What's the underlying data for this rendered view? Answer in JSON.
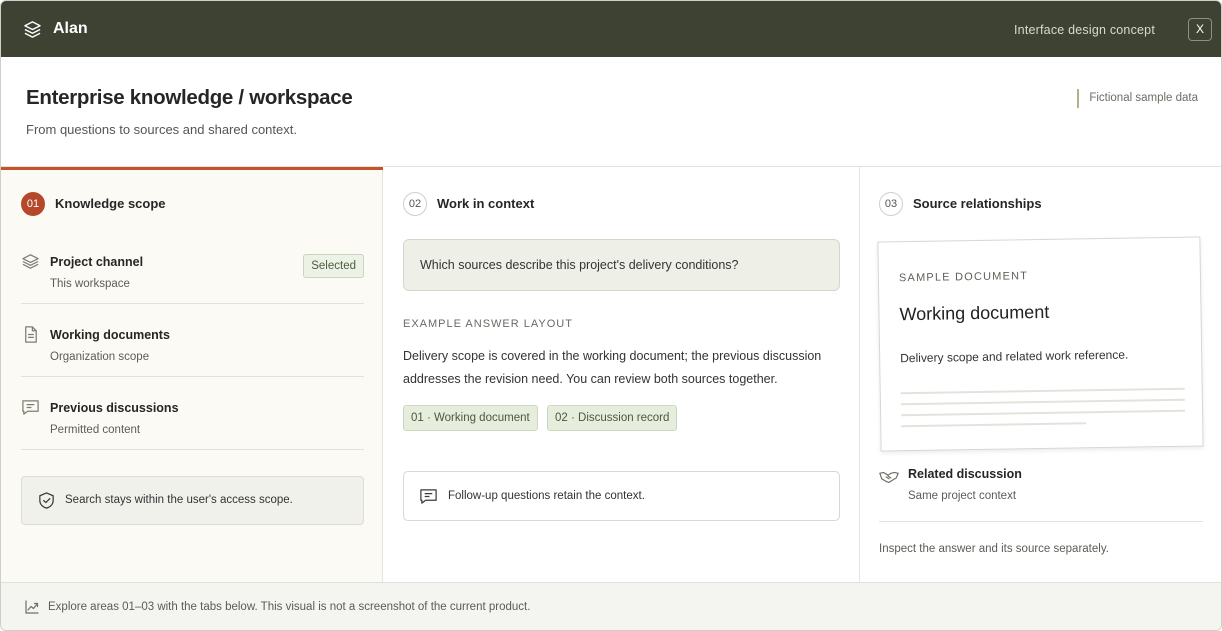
{
  "app": {
    "name": "Alan",
    "concept_label": "Interface design concept",
    "close_label": "X"
  },
  "header": {
    "title": "Enterprise knowledge / workspace",
    "subtitle": "From questions to sources and shared context.",
    "sample_tag": "Fictional sample data"
  },
  "columns": [
    {
      "num": "01",
      "title": "Knowledge scope"
    },
    {
      "num": "02",
      "title": "Work in context"
    },
    {
      "num": "03",
      "title": "Source relationships"
    }
  ],
  "scope": {
    "items": [
      {
        "name": "Project channel",
        "desc": "This workspace",
        "icon": "layers-icon",
        "badge": "Selected"
      },
      {
        "name": "Working documents",
        "desc": "Organization scope",
        "icon": "document-icon"
      },
      {
        "name": "Previous discussions",
        "desc": "Permitted content",
        "icon": "chat-icon"
      }
    ],
    "access_note": "Search stays within the user's access scope."
  },
  "work": {
    "question": "Which sources describe this project's delivery conditions?",
    "answer_label": "EXAMPLE ANSWER LAYOUT",
    "answer_line1": "Delivery scope is covered in the working document; the previous discussion",
    "answer_line2": "addresses the revision need. You can review both sources together.",
    "citations": [
      "01 · Working document",
      "02 · Discussion record"
    ],
    "followup": "Follow-up questions retain the context."
  },
  "sources": {
    "doc_eyebrow": "SAMPLE DOCUMENT",
    "doc_title": "Working document",
    "doc_desc": "Delivery scope and related work reference.",
    "related_title": "Related discussion",
    "related_desc": "Same project context",
    "inspect": "Inspect the answer and its source separately."
  },
  "footer": {
    "text": "Explore areas 01–03 with the tabs below. This visual is not a screenshot of the current product."
  },
  "colors": {
    "topbar": "#3d4233",
    "accent": "#c2532e",
    "step_active": "#b5482a",
    "badge_bg": "#edf2e6"
  }
}
